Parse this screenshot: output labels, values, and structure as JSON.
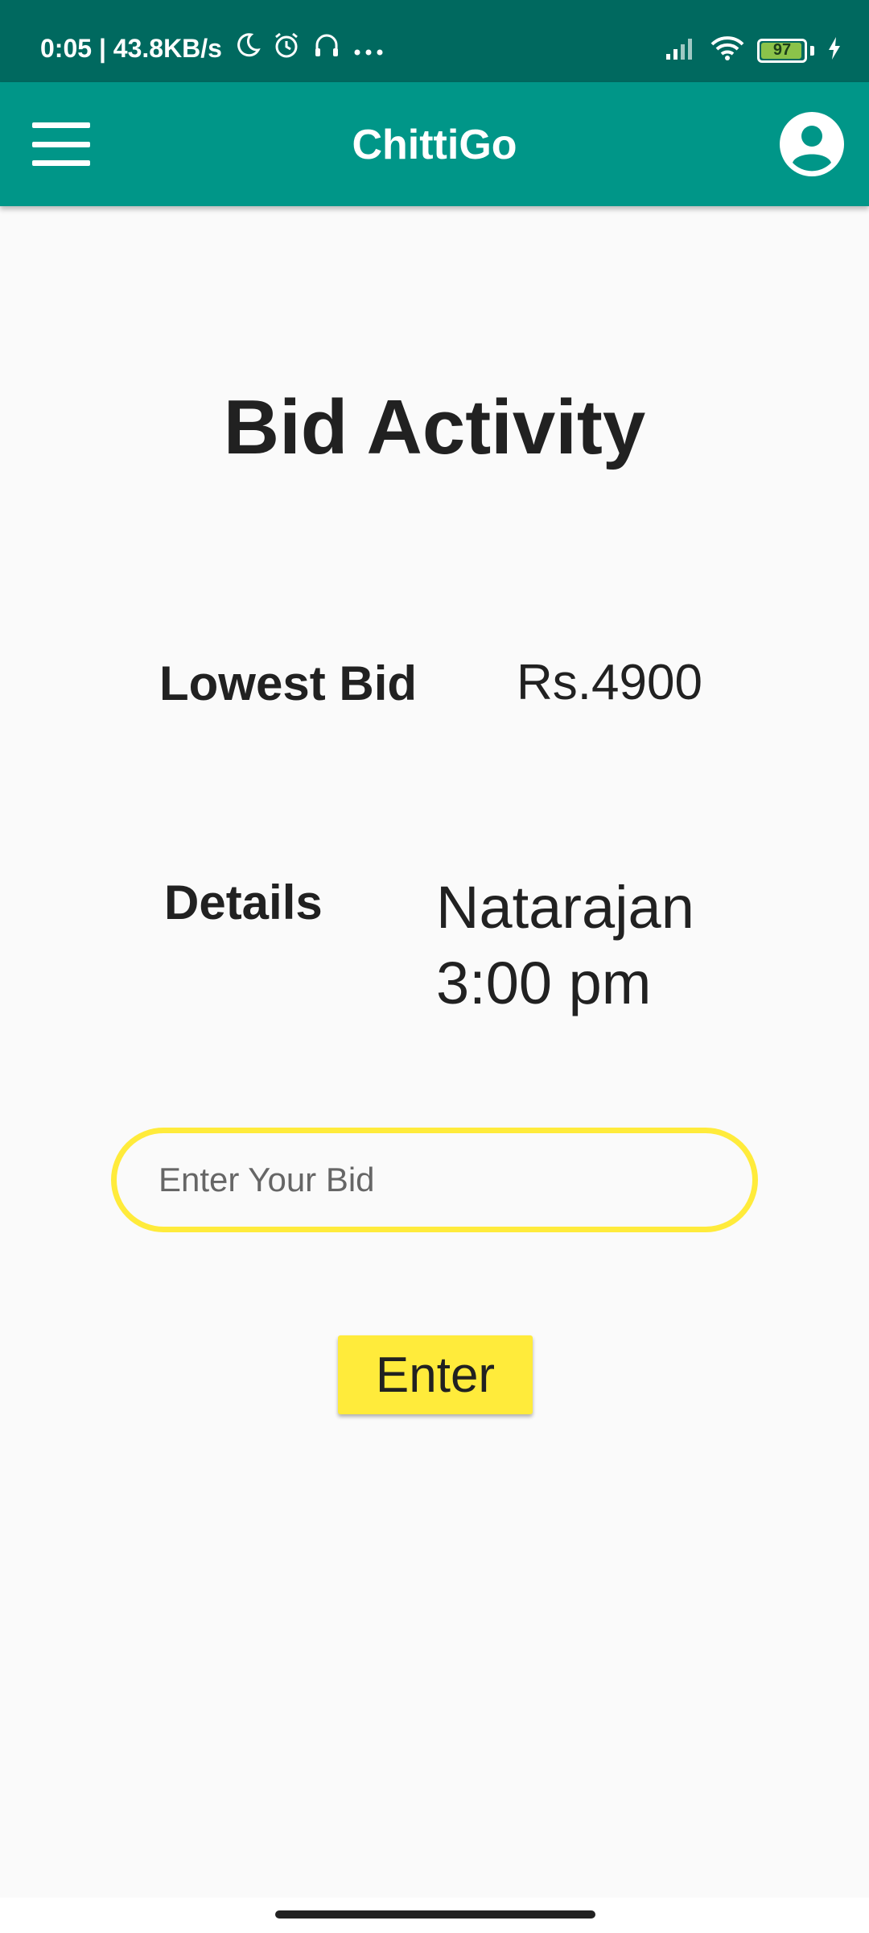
{
  "status_bar": {
    "time_speed": "0:05 | 43.8KB/s",
    "battery_level": "97",
    "battery_fraction": 0.97,
    "icons": [
      "moon-icon",
      "alarm-icon",
      "headphones-icon",
      "more-dots-icon",
      "signal-icon",
      "wifi-icon",
      "battery-icon",
      "charging-icon"
    ]
  },
  "app_bar": {
    "title": "ChittiGo",
    "menu_icon": "hamburger-menu-icon",
    "account_icon": "account-circle-icon"
  },
  "main": {
    "title": "Bid Activity",
    "lowest_bid": {
      "label": "Lowest Bid",
      "value": "Rs.4900"
    },
    "details": {
      "label": "Details",
      "name": "Natarajan",
      "time": "3:00 pm"
    },
    "bid_input": {
      "placeholder": "Enter Your Bid",
      "value": ""
    },
    "enter_button": "Enter"
  },
  "colors": {
    "status_bar": "#00695f",
    "app_bar": "#009688",
    "accent": "#ffeb3b",
    "background": "#fafafa",
    "text": "#212121"
  }
}
